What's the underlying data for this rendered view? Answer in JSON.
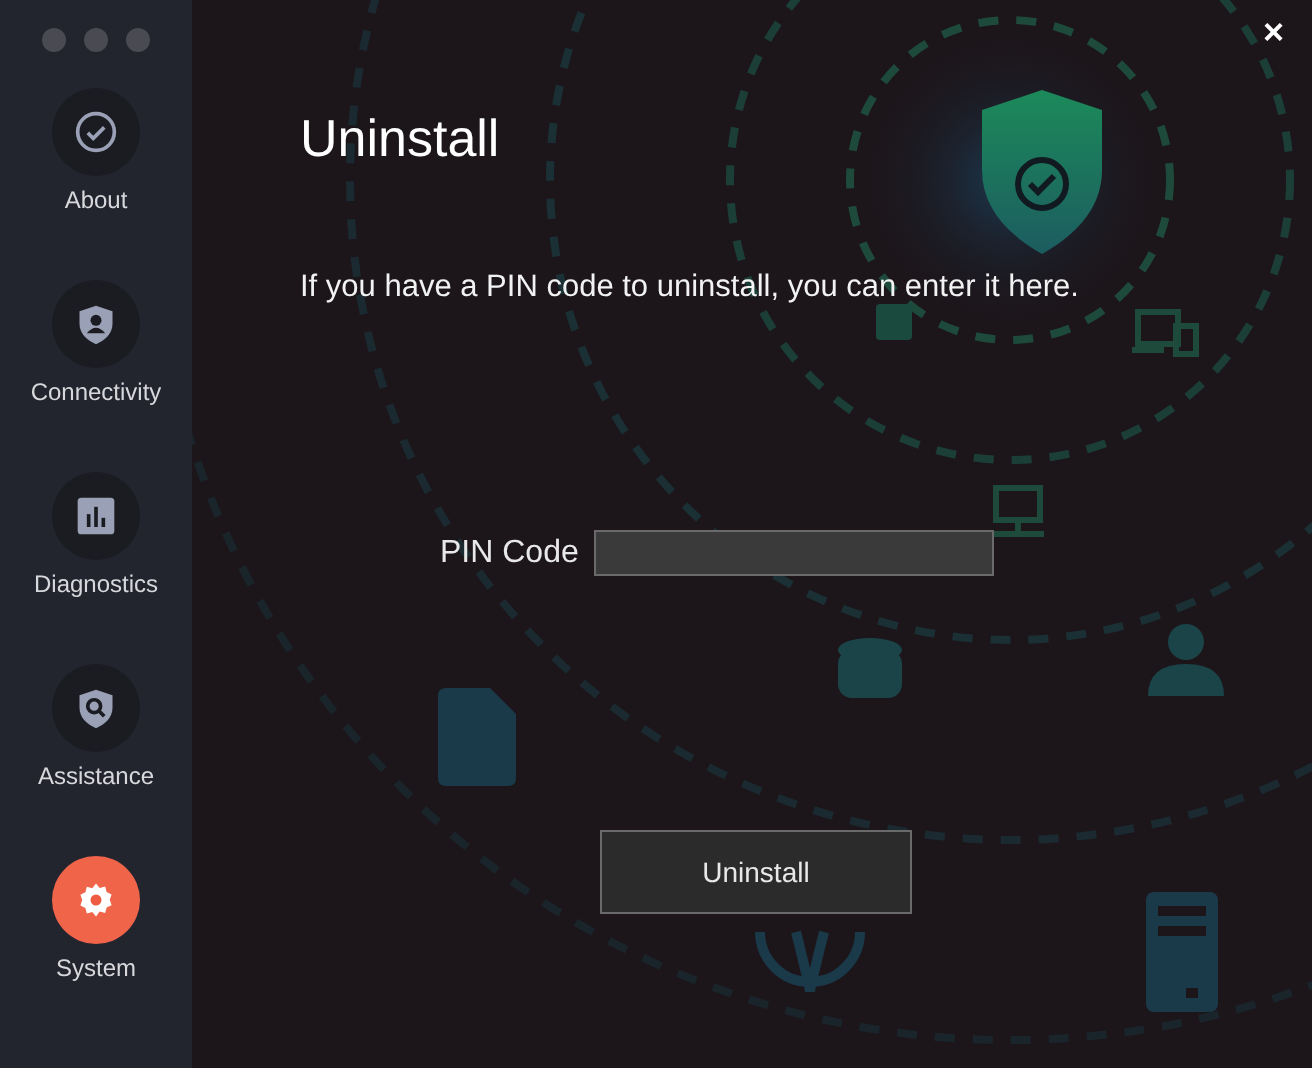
{
  "window": {
    "close": "×"
  },
  "sidebar": {
    "items": [
      {
        "label": "About",
        "selected": false
      },
      {
        "label": "Connectivity",
        "selected": false
      },
      {
        "label": "Diagnostics",
        "selected": false
      },
      {
        "label": "Assistance",
        "selected": false
      },
      {
        "label": "System",
        "selected": true
      }
    ]
  },
  "title": "Uninstall",
  "description": "If you have a PIN code to uninstall, you can enter it here.",
  "pin": {
    "label": "PIN Code"
  },
  "button": "Uninstall"
}
